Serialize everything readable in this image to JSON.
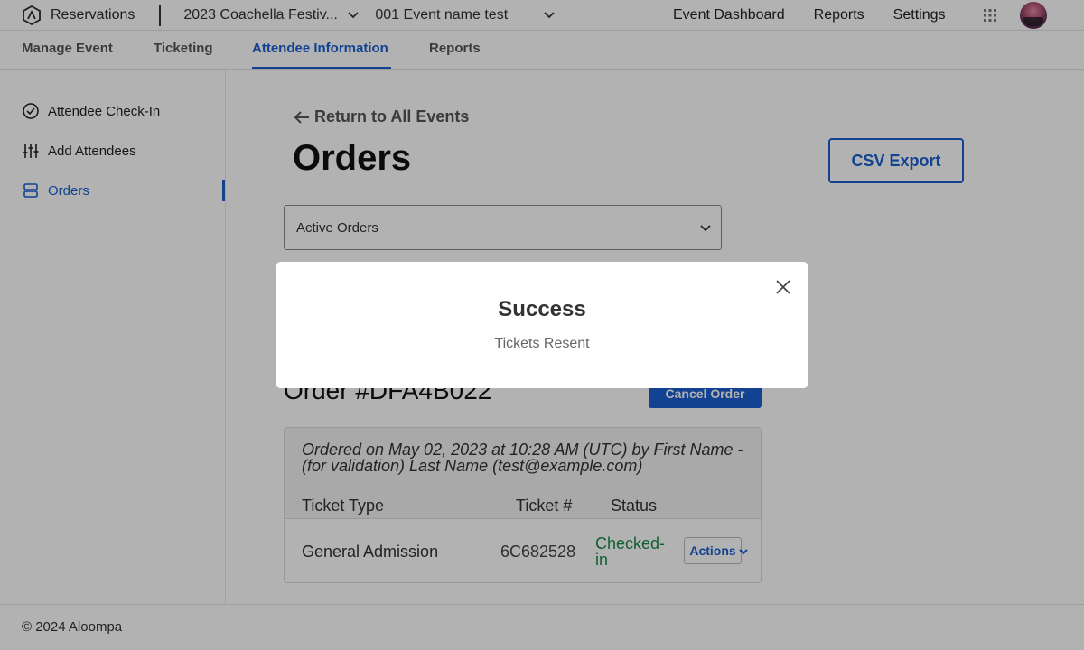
{
  "topbar": {
    "brand": "Reservations",
    "event_selector": "2023 Coachella Festiv...",
    "show_selector": "001 Event name test",
    "nav": [
      "Event Dashboard",
      "Reports",
      "Settings"
    ]
  },
  "subnav": {
    "tabs": [
      "Manage Event",
      "Ticketing",
      "Attendee Information",
      "Reports"
    ],
    "active": "Attendee Information"
  },
  "sidebar": {
    "items": [
      "Attendee Check-In",
      "Add Attendees",
      "Orders"
    ],
    "active": "Orders"
  },
  "main": {
    "back_link": "Return to All Events",
    "page_title": "Orders",
    "csv_button": "CSV Export",
    "filter_value": "Active Orders",
    "order": {
      "title": "Order #DFA4B022",
      "cancel_button": "Cancel Order",
      "ordered_on": "Ordered on May 02, 2023 at 10:28 AM (UTC) by First Name - (for validation) Last Name (test@example.com)",
      "columns": [
        "Ticket Type",
        "Ticket #",
        "Status"
      ],
      "row": {
        "ticket_type": "General Admission",
        "ticket_number": "6C682528",
        "status": "Checked-in",
        "actions_label": "Actions"
      }
    }
  },
  "footer": {
    "copyright": "© 2024 Aloompa"
  },
  "modal": {
    "title": "Success",
    "message": "Tickets Resent"
  },
  "colors": {
    "accent": "#1a5fd0",
    "success": "#1a8a4a",
    "overlay": "rgba(0,0,0,0.3)"
  }
}
